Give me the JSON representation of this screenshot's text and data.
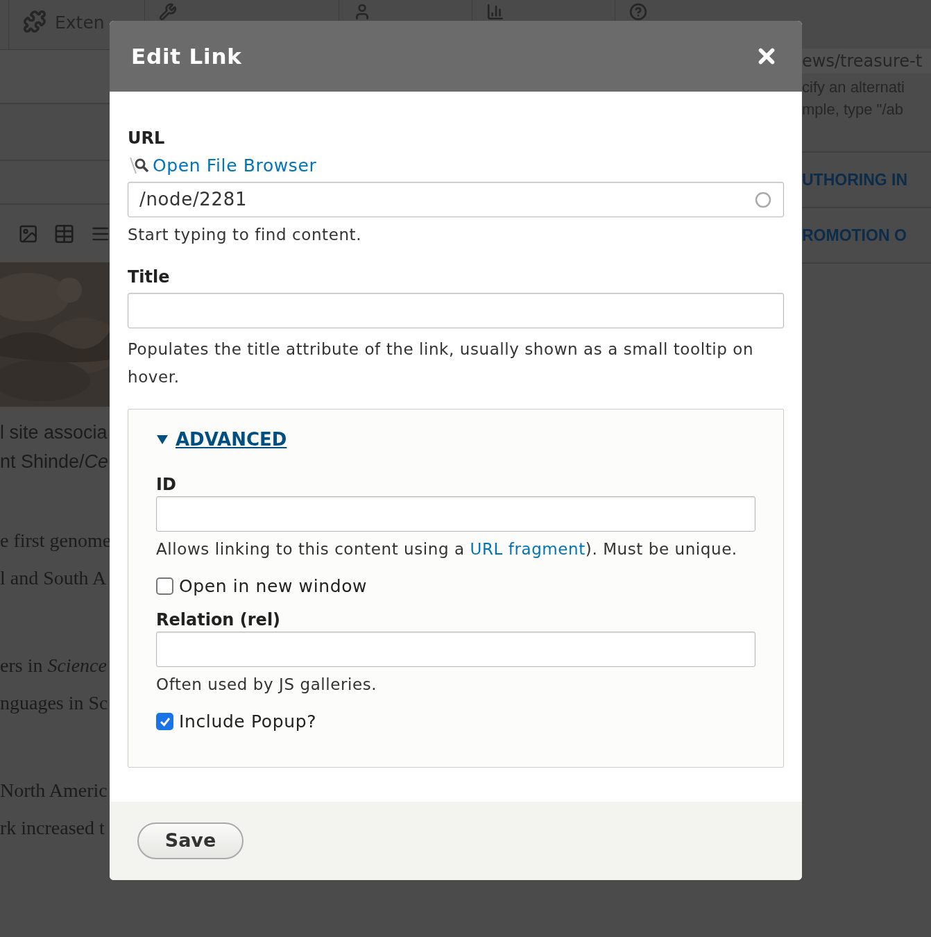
{
  "toolbar_label": "Exten",
  "left_lines": [
    {
      "kind": "sans",
      "text": "l site associa"
    },
    {
      "kind": "sans",
      "text": "nt Shinde/*Ce*"
    },
    {
      "kind": "gap"
    },
    {
      "kind": "serif",
      "text": "e first genome"
    },
    {
      "kind": "serif",
      "text": "l and South A"
    },
    {
      "kind": "gap"
    },
    {
      "kind": "serif",
      "text": "ers in *Science*"
    },
    {
      "kind": "serif",
      "text": "nguages in Sc"
    },
    {
      "kind": "gap"
    },
    {
      "kind": "serif",
      "text": "North Americ"
    },
    {
      "kind": "serif",
      "text": "rk increased t"
    }
  ],
  "right_panel": {
    "url_value": "ews/treasure-t",
    "help_lines": [
      "cify an alternati",
      "mple, type \"/ab"
    ],
    "sections": [
      "UTHORING IN",
      "ROMOTION O"
    ]
  },
  "dialog": {
    "title": "Edit Link",
    "url": {
      "label": "URL",
      "browser_link": "Open File Browser",
      "value": "/node/2281",
      "description": "Start typing to find content."
    },
    "title_field": {
      "label": "Title",
      "description": "Populates the title attribute of the link, usually shown as a small tooltip on hover."
    },
    "advanced": {
      "summary": "ADVANCED",
      "expanded": true,
      "items": [
        {
          "kind": "field",
          "label": "ID",
          "description": [
            {
              "kind": "text",
              "text": "Allows linking to this content using a "
            },
            {
              "kind": "link",
              "text": "URL fragment"
            },
            {
              "kind": "text",
              "text": "). Must be unique."
            }
          ]
        },
        {
          "kind": "checkbox",
          "label": "Open in new window",
          "checked": false
        },
        {
          "kind": "field",
          "label": "Relation (rel)",
          "description": [
            {
              "kind": "text",
              "text": "Often used by JS galleries."
            }
          ]
        },
        {
          "kind": "checkbox",
          "label": "Include Popup?",
          "checked": true
        }
      ]
    },
    "save": "Save"
  }
}
